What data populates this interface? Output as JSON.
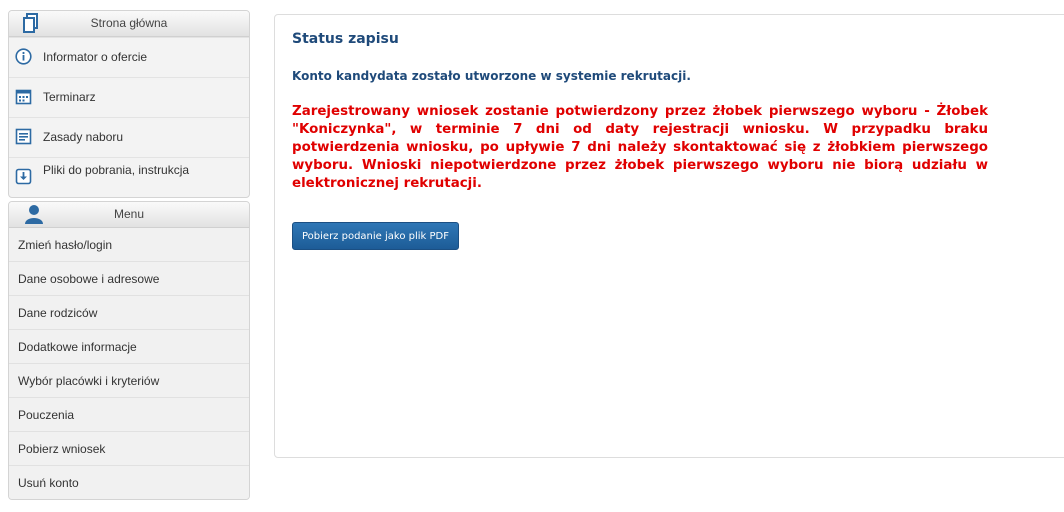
{
  "sidebar": {
    "info_panel": {
      "header": "Strona główna",
      "items": [
        {
          "label": "Informator o ofercie",
          "icon": "info-icon"
        },
        {
          "label": "Terminarz",
          "icon": "calendar-icon"
        },
        {
          "label": "Zasady naboru",
          "icon": "document-list-icon"
        },
        {
          "label": "Pliki do pobrania, instrukcja",
          "icon": "download-icon"
        }
      ]
    },
    "menu_panel": {
      "header": "Menu",
      "items": [
        {
          "label": "Zmień hasło/login"
        },
        {
          "label": "Dane osobowe i adresowe"
        },
        {
          "label": "Dane rodziców"
        },
        {
          "label": "Dodatkowe informacje"
        },
        {
          "label": "Wybór placówki i kryteriów"
        },
        {
          "label": "Pouczenia"
        },
        {
          "label": "Pobierz wniosek"
        },
        {
          "label": "Usuń konto"
        }
      ]
    }
  },
  "main": {
    "title": "Status zapisu",
    "info_text": "Konto kandydata zostało utworzone w systemie rekrutacji.",
    "warning_text": "Zarejestrowany wniosek zostanie potwierdzony przez żłobek pierwszego wyboru - Żłobek \"Koniczynka\", w terminie 7 dni od daty rejestracji wniosku. W przypadku braku potwierdzenia wniosku, po upływie 7 dni należy skontaktować się z żłobkiem pierwszego wyboru. Wnioski niepotwierdzone przez żłobek pierwszego wyboru nie biorą udziału w elektronicznej rekrutacji.",
    "pdf_button_label": "Pobierz podanie jako plik PDF"
  },
  "colors": {
    "title": "#1f4a7a",
    "warning": "#e00000",
    "button": "#2568a6",
    "icon": "#2d6aa3"
  }
}
